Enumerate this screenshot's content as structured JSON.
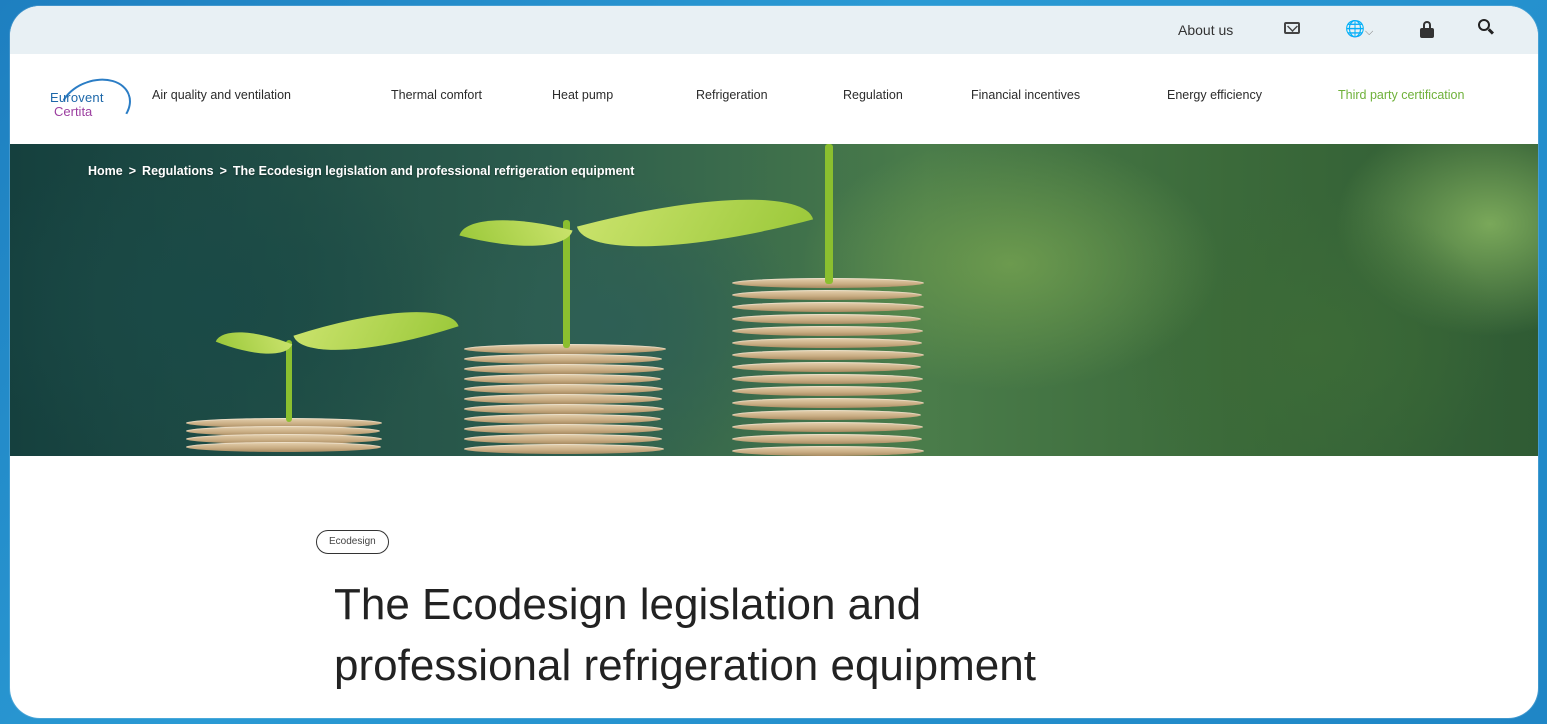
{
  "utility": {
    "about_label": "About us",
    "globe_icon": "globe-icon",
    "globe_glyph": "🌐",
    "chevron_glyph": "⌵"
  },
  "logo": {
    "line1": "Eurovent",
    "line2": "Certita"
  },
  "nav": {
    "items": [
      "Air quality and ventilation",
      "Thermal comfort",
      "Heat pump",
      "Refrigeration",
      "Regulation",
      "Financial incentives",
      "Energy efficiency",
      "Third party certification"
    ],
    "accent_color": "#6fb13a"
  },
  "breadcrumb": {
    "home": "Home",
    "sep": ">",
    "regulations": "Regulations",
    "current": "The Ecodesign legislation and professional refrigeration equipment"
  },
  "article": {
    "tag": "Ecodesign",
    "title_line1": "The Ecodesign legislation and",
    "title_line2": "professional refrigeration equipment"
  }
}
